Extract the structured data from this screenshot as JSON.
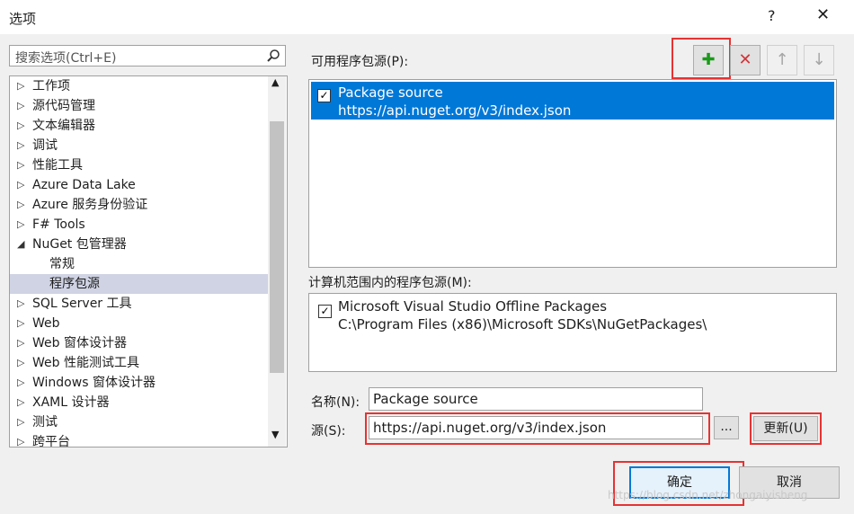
{
  "window": {
    "title": "选项",
    "help_label": "?",
    "close_label": "✕"
  },
  "search": {
    "placeholder": "搜索选项(Ctrl+E)",
    "icon": "search-icon"
  },
  "tree": {
    "items": [
      {
        "label": "工作项",
        "arrow": "▷"
      },
      {
        "label": "源代码管理",
        "arrow": "▷"
      },
      {
        "label": "文本编辑器",
        "arrow": "▷"
      },
      {
        "label": "调试",
        "arrow": "▷"
      },
      {
        "label": "性能工具",
        "arrow": "▷"
      },
      {
        "label": "Azure Data Lake",
        "arrow": "▷"
      },
      {
        "label": "Azure 服务身份验证",
        "arrow": "▷"
      },
      {
        "label": "F# Tools",
        "arrow": "▷"
      },
      {
        "label": "NuGet 包管理器",
        "arrow": "◢"
      },
      {
        "label": "常规",
        "arrow": ""
      },
      {
        "label": "程序包源",
        "arrow": ""
      },
      {
        "label": "SQL Server 工具",
        "arrow": "▷"
      },
      {
        "label": "Web",
        "arrow": "▷"
      },
      {
        "label": "Web 窗体设计器",
        "arrow": "▷"
      },
      {
        "label": "Web 性能测试工具",
        "arrow": "▷"
      },
      {
        "label": "Windows 窗体设计器",
        "arrow": "▷"
      },
      {
        "label": "XAML 设计器",
        "arrow": "▷"
      },
      {
        "label": "测试",
        "arrow": "▷"
      },
      {
        "label": "跨平台",
        "arrow": "▷"
      }
    ],
    "selected_label": "程序包源"
  },
  "available_sources": {
    "label": "可用程序包源(P):",
    "buttons": {
      "add": "✚",
      "remove": "✕",
      "up": "↑",
      "down": "↓"
    },
    "items": [
      {
        "name": "Package source",
        "url": "https://api.nuget.org/v3/index.json",
        "checked": "✓"
      }
    ]
  },
  "machine_sources": {
    "label": "计算机范围内的程序包源(M):",
    "items": [
      {
        "name": "Microsoft Visual Studio Offline Packages",
        "url": "C:\\Program Files (x86)\\Microsoft SDKs\\NuGetPackages\\",
        "checked": "✓"
      }
    ]
  },
  "form": {
    "name_label": "名称(N):",
    "name_value": "Package source",
    "source_label": "源(S):",
    "source_value": "https://api.nuget.org/v3/index.json",
    "browse_label": "...",
    "update_label": "更新(U)"
  },
  "footer": {
    "ok_label": "确定",
    "cancel_label": "取消"
  },
  "watermark": "https://blog.csdn.net/zhongaiyisheng",
  "colors": {
    "selection": "#0078d7",
    "highlight": "#e53333",
    "add_green": "#1a9a1a",
    "remove_red": "#d13438"
  }
}
